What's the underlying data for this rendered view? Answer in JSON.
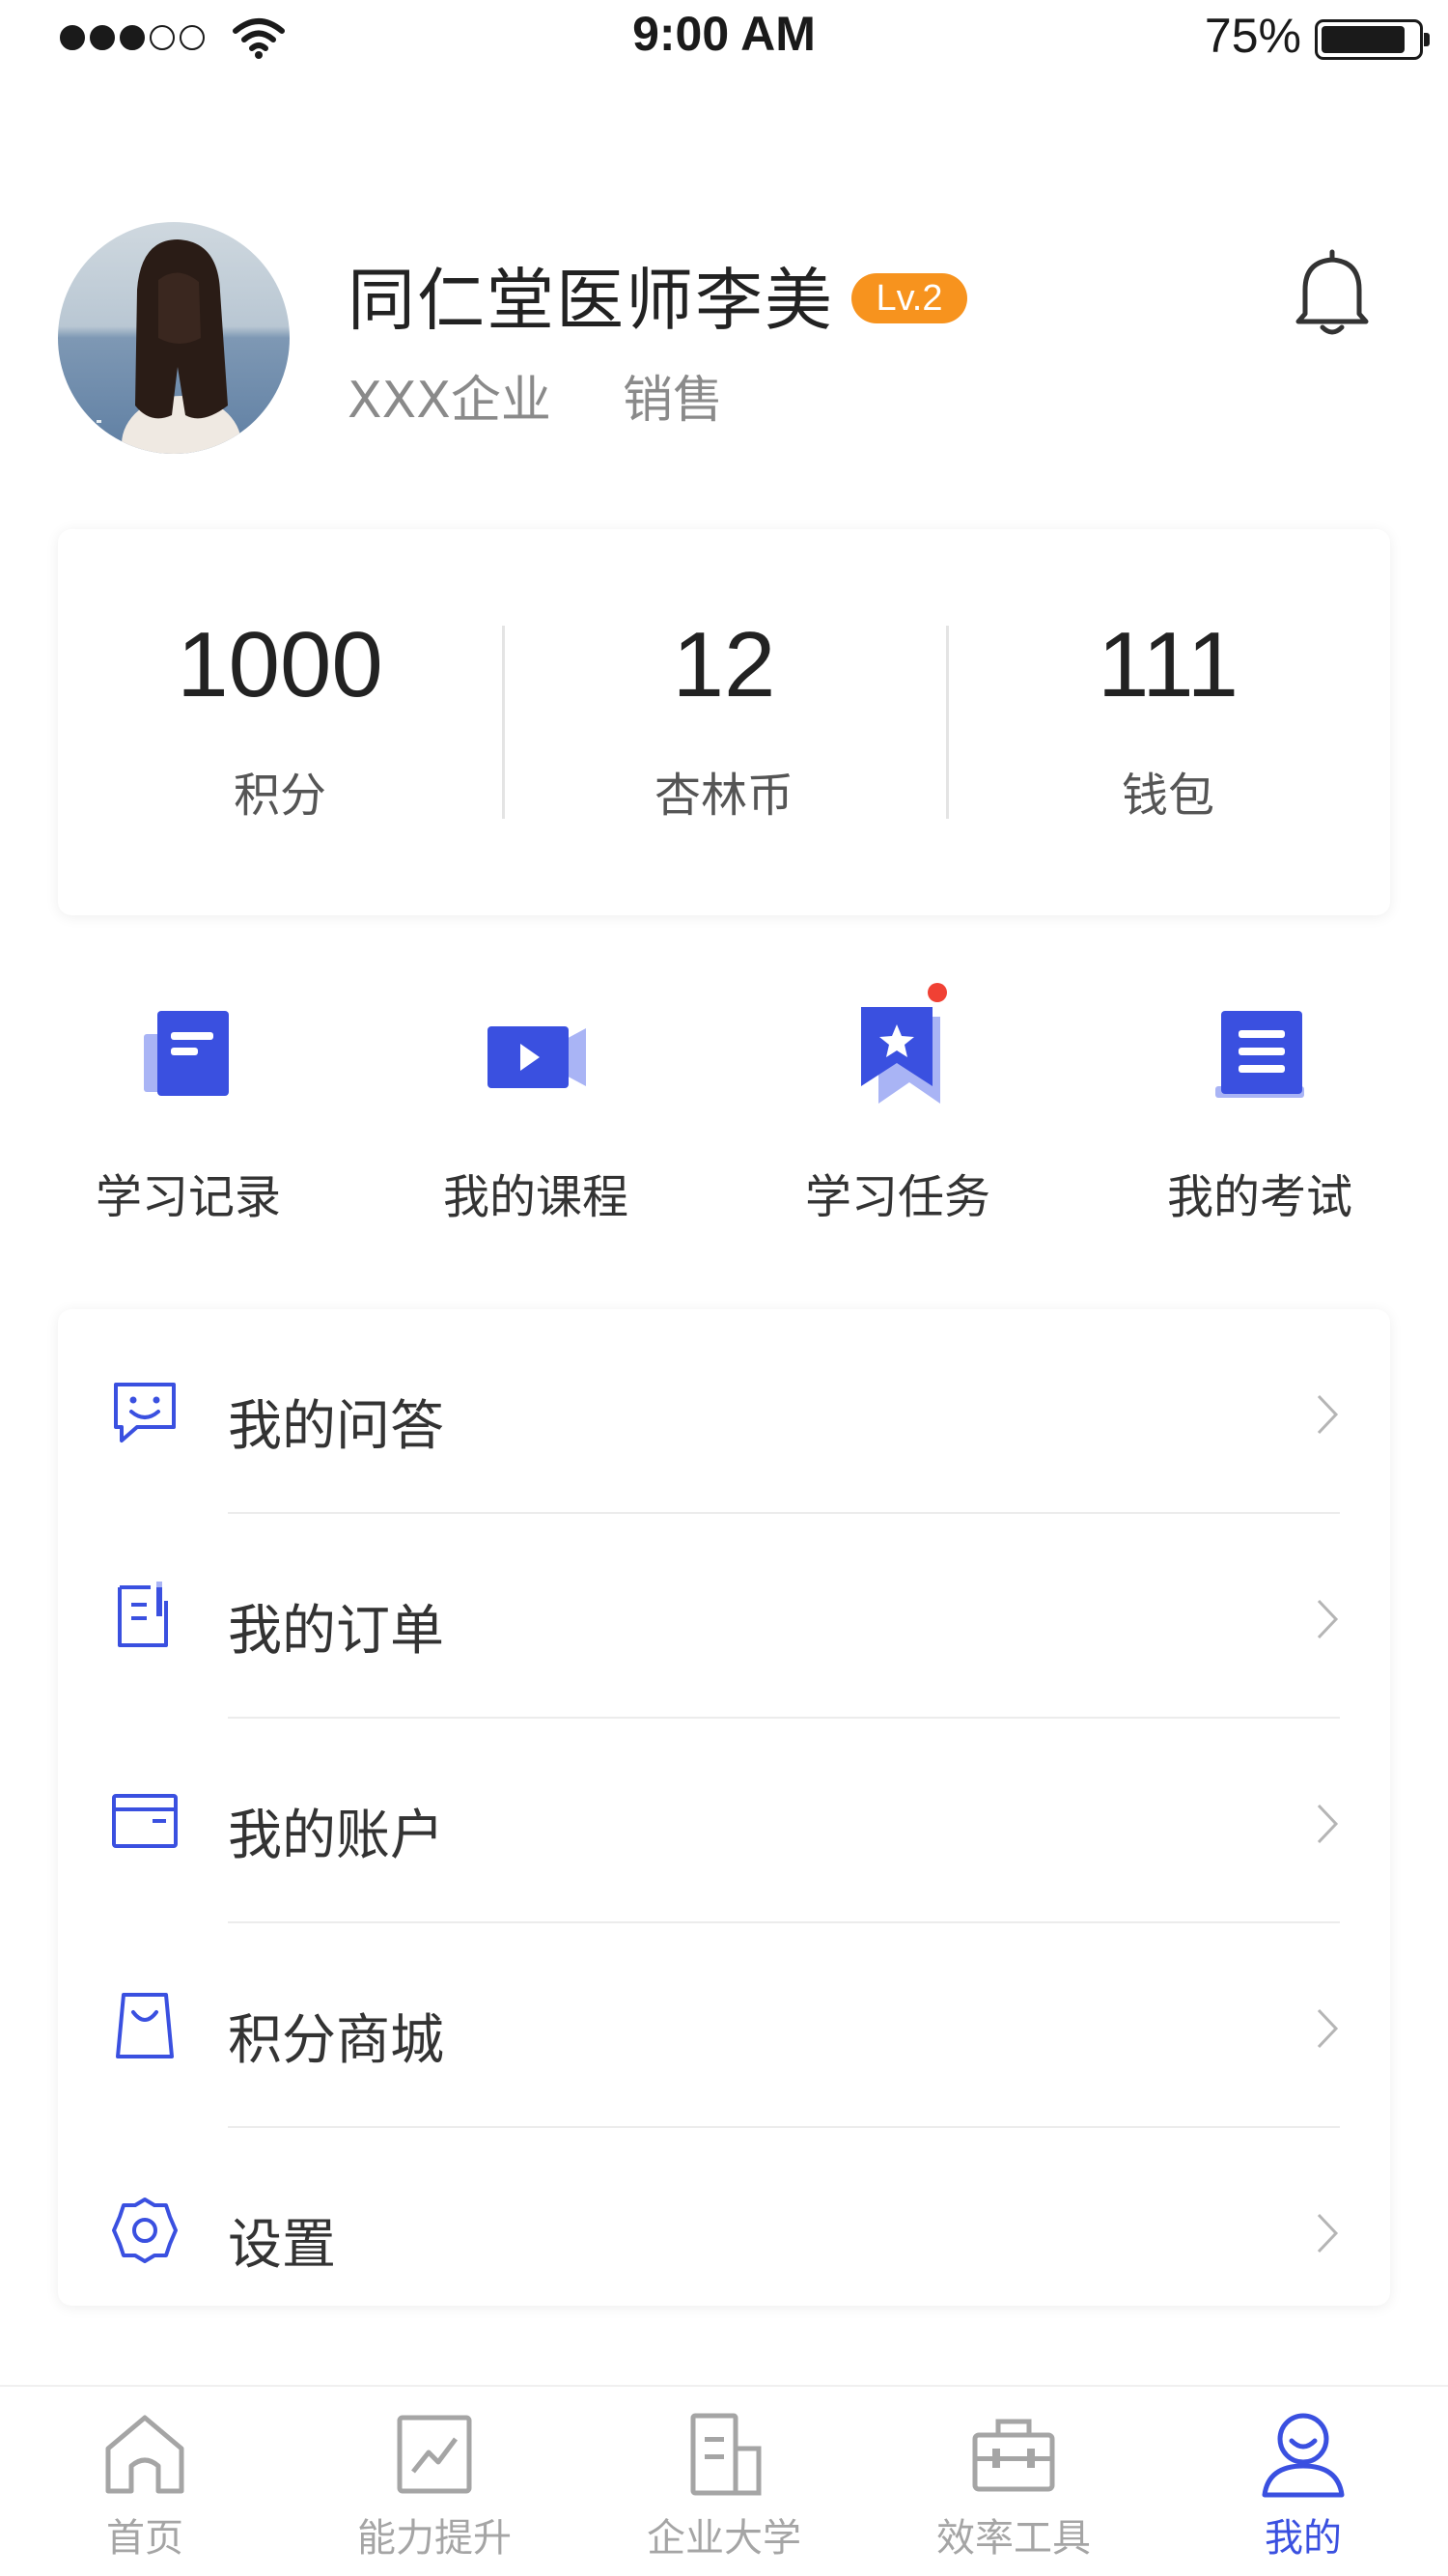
{
  "status_bar": {
    "time": "9:00 AM",
    "battery": "75%",
    "signal_bars": 3
  },
  "profile": {
    "name": "同仁堂医师李美",
    "level": "Lv.2",
    "company": "XXX企业",
    "position": "销售"
  },
  "stats": [
    {
      "value": "1000",
      "label": "积分"
    },
    {
      "value": "12",
      "label": "杏林币"
    },
    {
      "value": "111",
      "label": "钱包"
    }
  ],
  "quick_actions": [
    {
      "label": "学习记录",
      "icon": "document-icon"
    },
    {
      "label": "我的课程",
      "icon": "video-icon"
    },
    {
      "label": "学习任务",
      "icon": "bookmark-star-icon",
      "has_dot": true
    },
    {
      "label": "我的考试",
      "icon": "exam-list-icon"
    }
  ],
  "menu": [
    {
      "label": "我的问答",
      "icon": "chat-icon"
    },
    {
      "label": "我的订单",
      "icon": "order-icon"
    },
    {
      "label": "我的账户",
      "icon": "wallet-icon"
    },
    {
      "label": "积分商城",
      "icon": "shopping-bag-icon"
    },
    {
      "label": "设置",
      "icon": "gear-icon"
    }
  ],
  "tabs": [
    {
      "label": "首页",
      "icon": "home-icon",
      "active": false
    },
    {
      "label": "能力提升",
      "icon": "trend-icon",
      "active": false
    },
    {
      "label": "企业大学",
      "icon": "building-icon",
      "active": false
    },
    {
      "label": "效率工具",
      "icon": "toolbox-icon",
      "active": false
    },
    {
      "label": "我的",
      "icon": "user-icon",
      "active": true
    }
  ],
  "colors": {
    "accent": "#3a50e0",
    "accent_light": "#a9b4f5",
    "badge": "#f7931e",
    "notification_dot": "#f04134",
    "tab_inactive": "#a5a5a5"
  }
}
